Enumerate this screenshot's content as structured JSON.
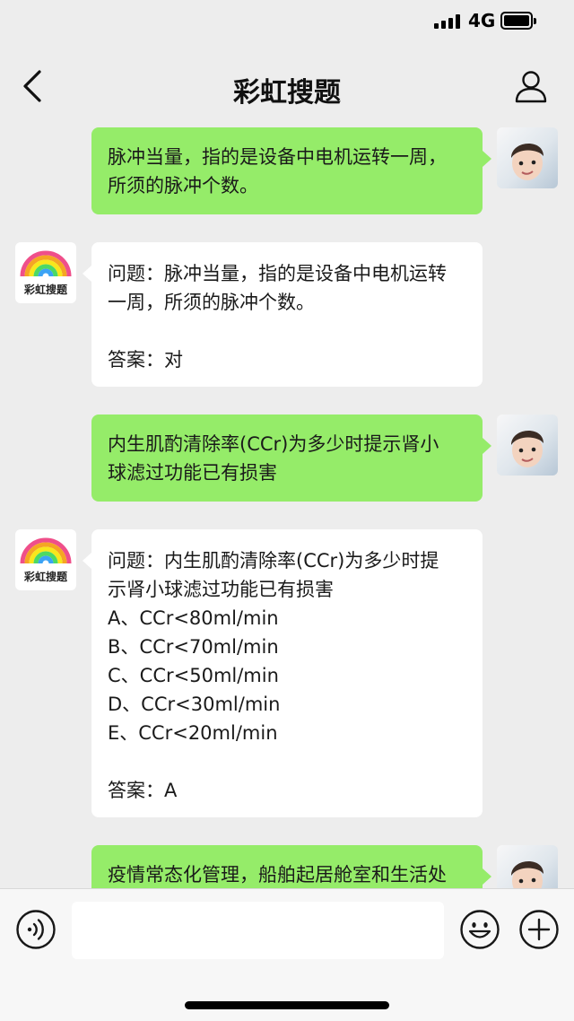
{
  "status_bar": {
    "network": "4G",
    "icons": [
      "signal-icon",
      "battery-icon"
    ]
  },
  "header": {
    "title": "彩虹搜题",
    "icons": [
      "back-chevron-icon",
      "profile-icon"
    ]
  },
  "bot": {
    "logo_text": "彩虹搜题"
  },
  "messages": [
    {
      "from": "user",
      "text": "脉冲当量，指的是设备中电机运转一周，\n所须的脉冲个数。"
    },
    {
      "from": "bot",
      "text": "问题：脉冲当量，指的是设备中电机运转\n一周，所须的脉冲个数。\n\n答案：对"
    },
    {
      "from": "user",
      "text": "内生肌酌清除率(CCr)为多少时提示肾小\n球滤过功能已有损害"
    },
    {
      "from": "bot",
      "text": "问题：内生肌酌清除率(CCr)为多少时提\n示肾小球滤过功能已有损害\nA、CCr<80ml/min\nB、CCr<70ml/min\nC、CCr<50ml/min\nD、CCr<30ml/min\nE、CCr<20ml/min\n\n答案：A"
    },
    {
      "from": "user",
      "text": "疫情常态化管理，船舶起居舱室和生活处"
    }
  ],
  "input_bar": {
    "placeholder": "",
    "icons": [
      "voice-icon",
      "emoji-icon",
      "plus-icon"
    ]
  },
  "colors": {
    "user_bubble": "#95ec69",
    "bot_bubble": "#ffffff",
    "background": "#ededed"
  }
}
